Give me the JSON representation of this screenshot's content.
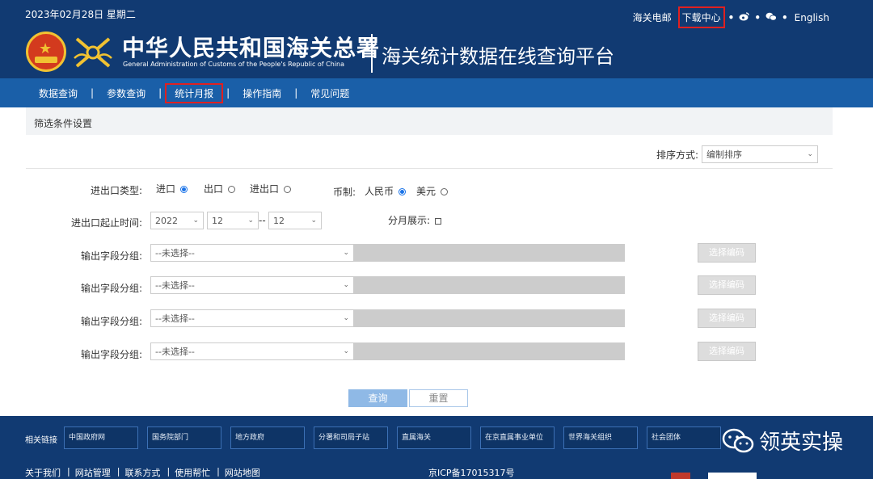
{
  "header": {
    "date": "2023年02月28日 星期二",
    "links": {
      "mail": "海关电邮",
      "download": "下载中心",
      "english": "English",
      "sep": "•"
    },
    "title_cn": "中华人民共和国海关总署",
    "title_en": "General Administration of Customs of the People's Republic of China",
    "platform": "海关统计数据在线查询平台"
  },
  "nav": {
    "items": [
      "数据查询",
      "参数查询",
      "统计月报",
      "操作指南",
      "常见问题"
    ],
    "sep": "|"
  },
  "filter": {
    "section_title": "筛选条件设置",
    "sort_label": "排序方式:",
    "sort_value": "编制排序",
    "trade_type_label": "进出口类型:",
    "trade_options": [
      "进口",
      "出口",
      "进出口"
    ],
    "trade_selected": "进口",
    "currency_label": "币制:",
    "currency_options": [
      "人民币",
      "美元"
    ],
    "currency_selected": "人民币",
    "period_label": "进出口起止时间:",
    "year": "2022",
    "month_start": "12",
    "dash": "--",
    "month_end": "12",
    "monthly_label": "分月展示:",
    "field_group_label": "输出字段分组:",
    "field_group_placeholder": "--未选择--",
    "select_code": "选择编码",
    "query": "查询",
    "reset": "重置"
  },
  "footer": {
    "related_label": "相关链接",
    "boxes": [
      "中国政府网",
      "国务院部门",
      "地方政府",
      "分署和司局子站",
      "直属海关",
      "在京直属事业单位",
      "世界海关组织",
      "社会团体"
    ],
    "bottom_links": [
      "关于我们",
      "网站管理",
      "联系方式",
      "使用帮忙",
      "网站地图"
    ],
    "icp": "京ICP备17015317号",
    "watermark": "领英实操"
  },
  "colors": {
    "header_bg": "#113a72",
    "nav_bg": "#1a5fa8",
    "highlight": "#e02020",
    "query_btn": "#8fb9e6"
  }
}
